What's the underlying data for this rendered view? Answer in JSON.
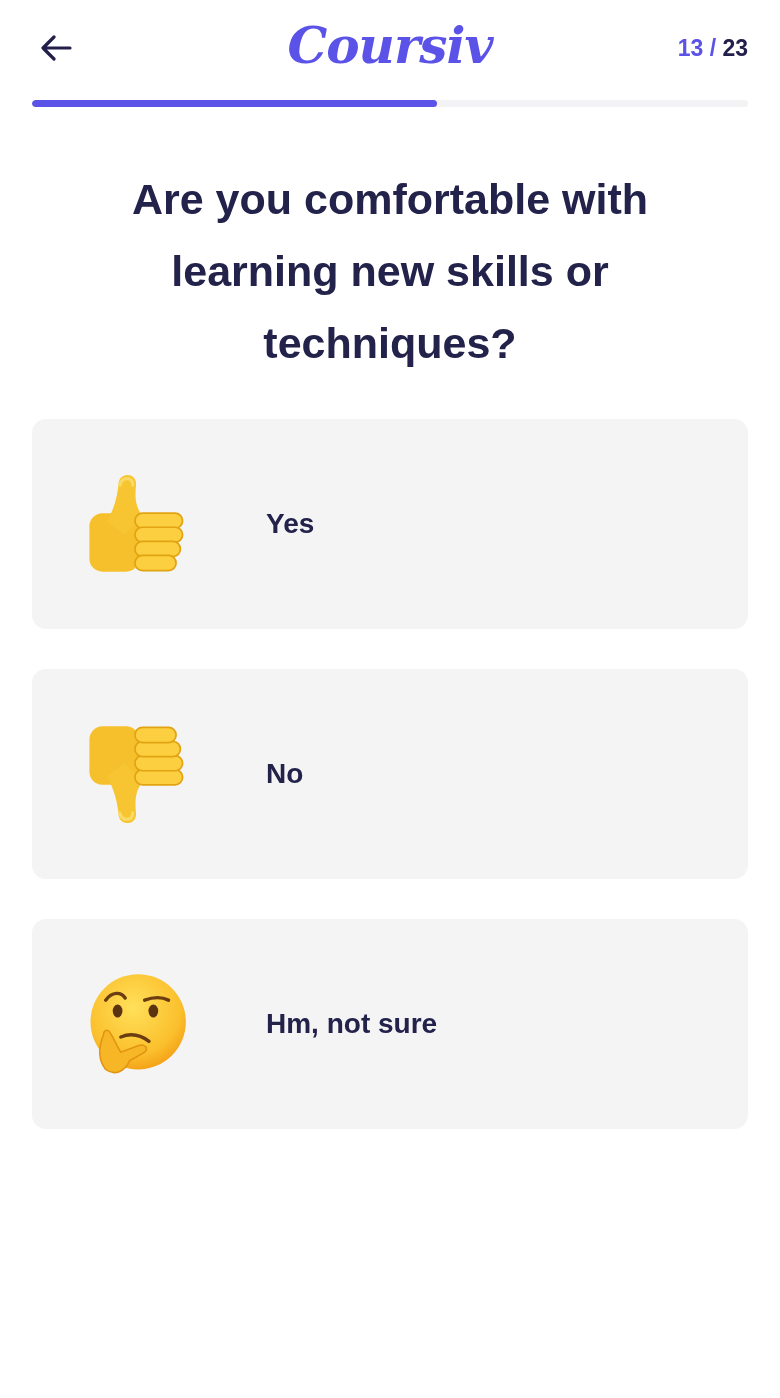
{
  "header": {
    "logo": "Coursiv",
    "counter": {
      "current": "13",
      "separator": "/",
      "total": "23"
    }
  },
  "progress": {
    "level": 0.565
  },
  "question": "Are you comfortable with learning new skills or techniques?",
  "options": [
    {
      "kind": "thumbs_up",
      "label": "Yes"
    },
    {
      "kind": "thumbs_down",
      "label": "No"
    },
    {
      "kind": "thinking",
      "label": "Hm, not sure"
    }
  ]
}
